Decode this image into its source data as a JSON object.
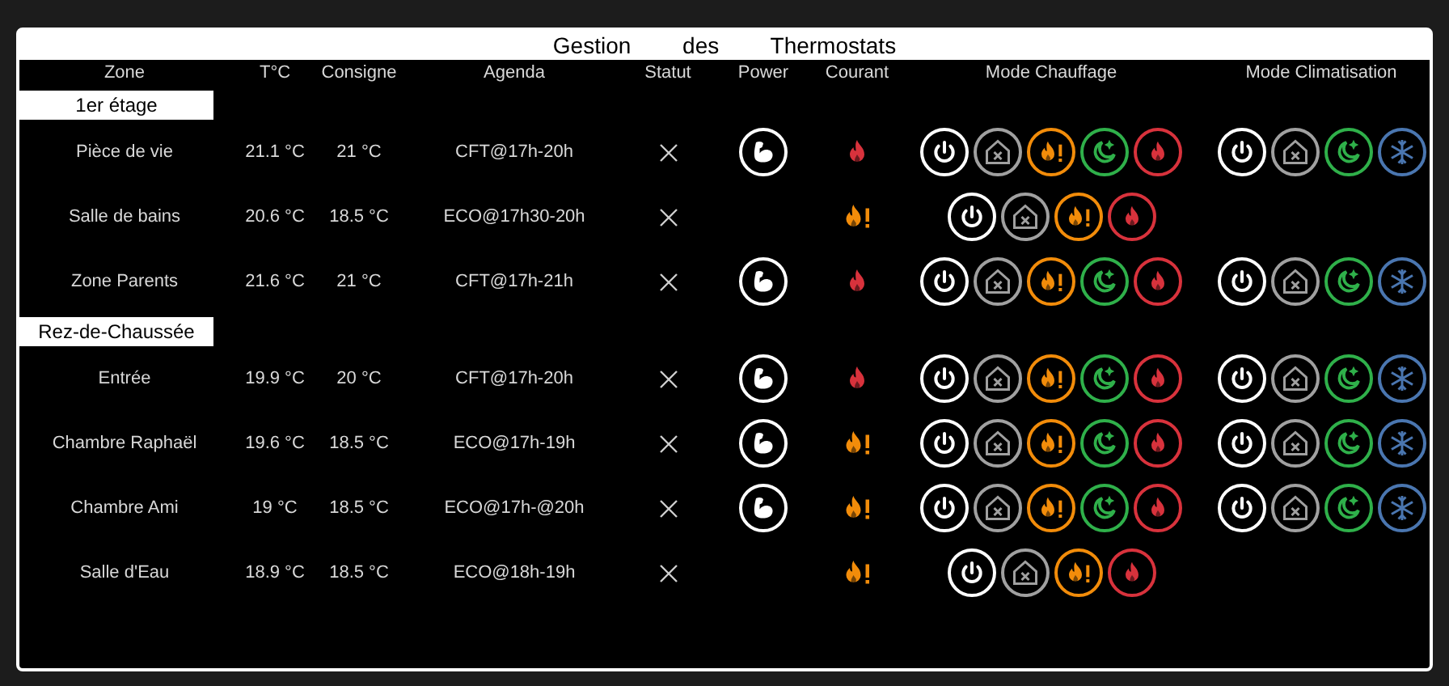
{
  "title": "Gestion des Thermostats",
  "columns": [
    "Zone",
    "T°C",
    "Consigne",
    "Agenda",
    "Statut",
    "Power",
    "Courant",
    "Mode Chauffage",
    "Mode Climatisation"
  ],
  "sections": [
    {
      "title": "1er étage",
      "rows": [
        {
          "zone": "Pièce de vie",
          "temp": "21.1 °C",
          "setpoint": "21 °C",
          "agenda": "CFT@17h-20h",
          "status": {
            "kind": "cross"
          },
          "power": true,
          "current": {
            "kind": "comfort"
          },
          "heating": [
            {
              "kind": "off"
            },
            {
              "kind": "away"
            },
            {
              "kind": "eco"
            },
            {
              "kind": "night"
            },
            {
              "kind": "comfort"
            }
          ],
          "cooling": [
            {
              "kind": "off"
            },
            {
              "kind": "away"
            },
            {
              "kind": "night"
            },
            {
              "kind": "frost"
            }
          ]
        },
        {
          "zone": "Salle de bains",
          "temp": "20.6 °C",
          "setpoint": "18.5 °C",
          "agenda": "ECO@17h30-20h",
          "status": {
            "kind": "cross"
          },
          "power": false,
          "current": {
            "kind": "eco"
          },
          "heating": [
            {
              "kind": "off"
            },
            {
              "kind": "away"
            },
            {
              "kind": "eco"
            },
            {
              "kind": "comfort"
            }
          ]
        },
        {
          "zone": "Zone Parents",
          "temp": "21.6 °C",
          "setpoint": "21 °C",
          "agenda": "CFT@17h-21h",
          "status": {
            "kind": "cross"
          },
          "power": true,
          "current": {
            "kind": "comfort"
          },
          "heating": [
            {
              "kind": "off"
            },
            {
              "kind": "away"
            },
            {
              "kind": "eco"
            },
            {
              "kind": "night"
            },
            {
              "kind": "comfort"
            }
          ],
          "cooling": [
            {
              "kind": "off"
            },
            {
              "kind": "away"
            },
            {
              "kind": "night"
            },
            {
              "kind": "frost"
            }
          ]
        }
      ]
    },
    {
      "title": "Rez-de-Chaussée",
      "rows": [
        {
          "zone": "Entrée",
          "temp": "19.9 °C",
          "setpoint": "20 °C",
          "agenda": "CFT@17h-20h",
          "status": {
            "kind": "cross"
          },
          "power": true,
          "current": {
            "kind": "comfort"
          },
          "heating": [
            {
              "kind": "off"
            },
            {
              "kind": "away"
            },
            {
              "kind": "eco"
            },
            {
              "kind": "night"
            },
            {
              "kind": "comfort"
            }
          ],
          "cooling": [
            {
              "kind": "off"
            },
            {
              "kind": "away"
            },
            {
              "kind": "night"
            },
            {
              "kind": "frost"
            }
          ]
        },
        {
          "zone": "Chambre Raphaël",
          "temp": "19.6 °C",
          "setpoint": "18.5 °C",
          "agenda": "ECO@17h-19h",
          "status": {
            "kind": "cross"
          },
          "power": true,
          "current": {
            "kind": "eco"
          },
          "heating": [
            {
              "kind": "off"
            },
            {
              "kind": "away"
            },
            {
              "kind": "eco"
            },
            {
              "kind": "night"
            },
            {
              "kind": "comfort"
            }
          ],
          "cooling": [
            {
              "kind": "off"
            },
            {
              "kind": "away"
            },
            {
              "kind": "night"
            },
            {
              "kind": "frost"
            }
          ]
        },
        {
          "zone": "Chambre Ami",
          "temp": "19 °C",
          "setpoint": "18.5 °C",
          "agenda": "ECO@17h-@20h",
          "status": {
            "kind": "cross"
          },
          "power": true,
          "current": {
            "kind": "eco"
          },
          "heating": [
            {
              "kind": "off"
            },
            {
              "kind": "away"
            },
            {
              "kind": "eco"
            },
            {
              "kind": "night"
            },
            {
              "kind": "comfort"
            }
          ],
          "cooling": [
            {
              "kind": "off"
            },
            {
              "kind": "away"
            },
            {
              "kind": "night"
            },
            {
              "kind": "frost"
            }
          ]
        },
        {
          "zone": "Salle d'Eau",
          "temp": "18.9 °C",
          "setpoint": "18.5 °C",
          "agenda": "ECO@18h-19h",
          "status": {
            "kind": "cross"
          },
          "power": false,
          "current": {
            "kind": "eco"
          },
          "heating": [
            {
              "kind": "off"
            },
            {
              "kind": "away"
            },
            {
              "kind": "eco"
            },
            {
              "kind": "comfort"
            }
          ]
        }
      ]
    }
  ]
}
